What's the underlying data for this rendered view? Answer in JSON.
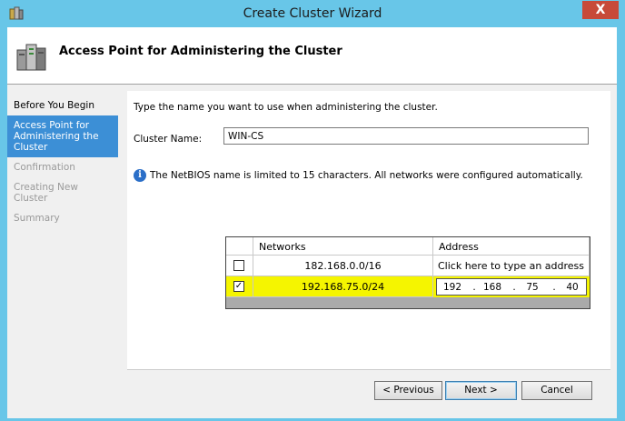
{
  "window": {
    "title": "Create Cluster Wizard",
    "close_label": "X"
  },
  "header": {
    "title": "Access Point for Administering the Cluster"
  },
  "nav": {
    "items": [
      {
        "label": "Before You Begin",
        "state": "done"
      },
      {
        "label": "Access Point for Administering the Cluster",
        "state": "active"
      },
      {
        "label": "Confirmation",
        "state": "pending"
      },
      {
        "label": "Creating New Cluster",
        "state": "pending"
      },
      {
        "label": "Summary",
        "state": "pending"
      }
    ]
  },
  "main": {
    "instruction": "Type the name you want to use when administering the cluster.",
    "cluster_name_label": "Cluster Name:",
    "cluster_name_value": "WIN-CS",
    "info_text": "The NetBIOS name is limited to 15 characters.  All networks were configured automatically.",
    "info_icon": "info-icon"
  },
  "networks": {
    "headers": {
      "networks": "Networks",
      "address": "Address"
    },
    "rows": [
      {
        "checked": false,
        "network": "182.168.0.0/16",
        "address": "Click here to type an address"
      },
      {
        "checked": true,
        "network": "192.168.75.0/24",
        "address_parts": [
          "192",
          "168",
          "75",
          "40"
        ]
      }
    ]
  },
  "buttons": {
    "previous": "< Previous",
    "next": "Next >",
    "cancel": "Cancel"
  },
  "colors": {
    "titlebar": "#68c6e8",
    "close": "#c74a39",
    "nav_active": "#3c8fd6",
    "highlight": "#f5f500"
  }
}
